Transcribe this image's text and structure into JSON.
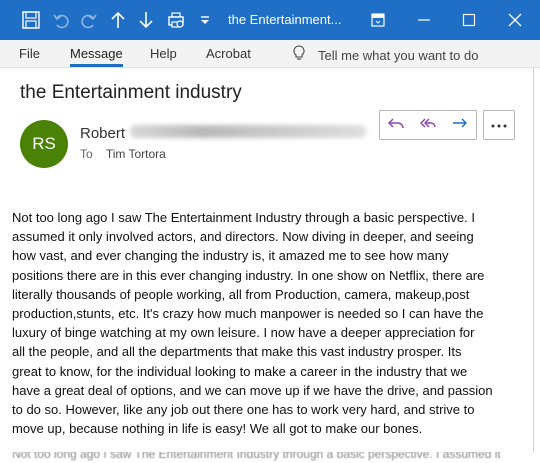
{
  "titlebar": {
    "title": "the Entertainment..."
  },
  "ribbon": {
    "tabs": [
      {
        "label": "File"
      },
      {
        "label": "Message",
        "active": true
      },
      {
        "label": "Help"
      },
      {
        "label": "Acrobat"
      }
    ],
    "tell_me": "Tell me what you want to do"
  },
  "message": {
    "subject": "the Entertainment industry",
    "avatar_initials": "RS",
    "avatar_color": "#498205",
    "sender_name": "Robert",
    "to_label": "To",
    "to_name": "Tim Tortora",
    "body_lines": [
      "Not too long ago I saw The Entertainment Industry through a basic perspective. I",
      "assumed it only involved actors, and directors.  Now diving in deeper, and seeing",
      "how vast, and ever changing the industry is, it amazed me to see how many",
      "positions there are in this ever changing industry. In one show on Netflix, there are",
      "literally thousands of people working, all from Production, camera, makeup,post",
      "production,stunts, etc. It's crazy how much manpower is needed so I can have the",
      "luxury of binge watching at my own leisure. I now have a deeper appreciation for",
      "all the people, and all the departments that make this vast industry prosper. Its",
      "great to know, for the individual looking to make a career in the industry that we",
      "have a great deal of options, and we can move up if we have the drive, and passion",
      "to do so. However, like any job out there one has to work very hard, and strive to",
      "move up, because nothing in life is easy! We all got to make our bones."
    ],
    "cutoff_text": "Not too long ago I saw The Entertainment Industry through a basic perspective. I assumed it"
  },
  "colors": {
    "titlebar_bg": "#1f6fc6",
    "accent": "#1f6fc6",
    "action_icon": "#8e44ad",
    "forward_icon": "#1f6fc6"
  },
  "icons": [
    "save-icon",
    "undo-icon",
    "redo-icon",
    "up-arrow-icon",
    "down-arrow-icon",
    "print-icon",
    "customize-dropdown-icon",
    "ribbon-display-icon",
    "minimize-icon",
    "maximize-icon",
    "close-icon",
    "lightbulb-icon",
    "reply-icon",
    "reply-all-icon",
    "forward-icon",
    "more-options-icon"
  ]
}
